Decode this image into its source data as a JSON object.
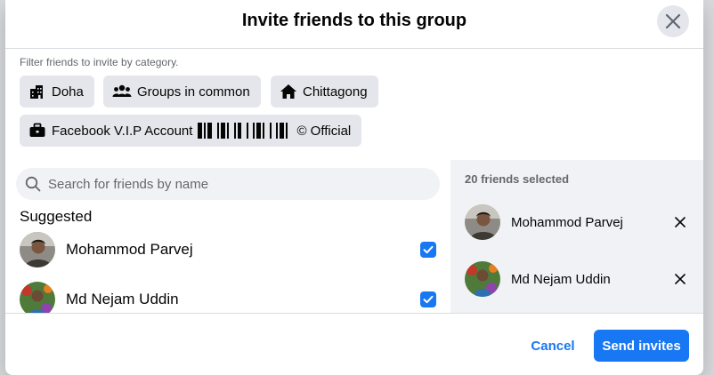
{
  "dialog": {
    "title": "Invite friends to this group",
    "close_icon": "close-icon"
  },
  "filters": {
    "label": "Filter friends to invite by category.",
    "chips": [
      {
        "label": "Doha",
        "icon": "city-icon"
      },
      {
        "label": "Groups in common",
        "icon": "people-icon"
      },
      {
        "label": "Chittagong",
        "icon": "home-icon"
      },
      {
        "label": "Facebook V.I.P Account",
        "suffix": "© Official",
        "icon": "briefcase-icon"
      }
    ]
  },
  "search": {
    "placeholder": "Search for friends by name",
    "icon": "search-icon"
  },
  "suggested": {
    "heading": "Suggested",
    "friends": [
      {
        "name": "Mohammod Parvej",
        "checked": true
      },
      {
        "name": "Md Nejam Uddin",
        "checked": true
      }
    ]
  },
  "selected": {
    "count_label": "20 friends selected",
    "friends": [
      {
        "name": "Mohammod Parvej"
      },
      {
        "name": "Md Nejam Uddin"
      }
    ]
  },
  "footer": {
    "cancel_label": "Cancel",
    "send_label": "Send invites"
  },
  "colors": {
    "accent": "#1877f2",
    "chip_bg": "#e4e6eb",
    "panel_bg": "#f0f2f5",
    "secondary_text": "#65676b"
  }
}
